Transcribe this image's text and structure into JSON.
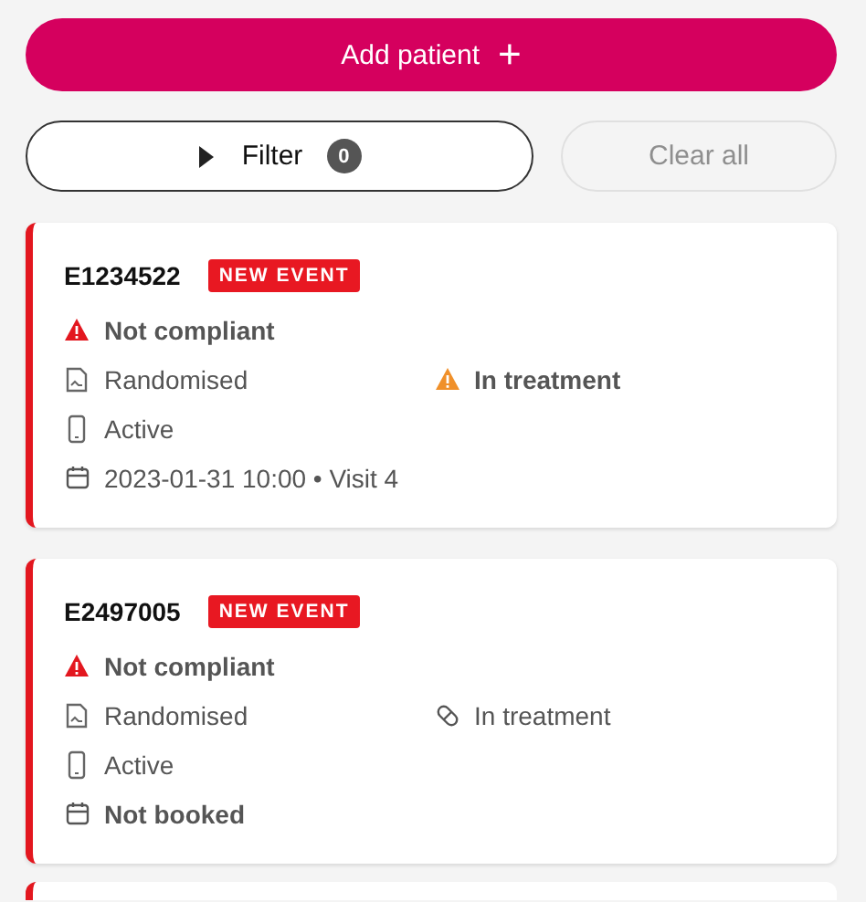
{
  "add_button": {
    "label": "Add patient",
    "icon": "+"
  },
  "filter": {
    "label": "Filter",
    "count": "0",
    "expanded": false
  },
  "clear_button": {
    "label": "Clear all",
    "disabled": true
  },
  "patients": [
    {
      "id": "E1234522",
      "badge": "NEW EVENT",
      "compliance": "Not compliant",
      "randomisation": "Randomised",
      "treatment": {
        "label": "In treatment",
        "kind": "warning"
      },
      "device": "Active",
      "visit": {
        "label": "2023-01-31 10:00 • Visit 4",
        "booked": true
      }
    },
    {
      "id": "E2497005",
      "badge": "NEW EVENT",
      "compliance": "Not compliant",
      "randomisation": "Randomised",
      "treatment": {
        "label": "In treatment",
        "kind": "normal"
      },
      "device": "Active",
      "visit": {
        "label": "Not booked",
        "booked": false
      }
    }
  ],
  "more_cards": true
}
